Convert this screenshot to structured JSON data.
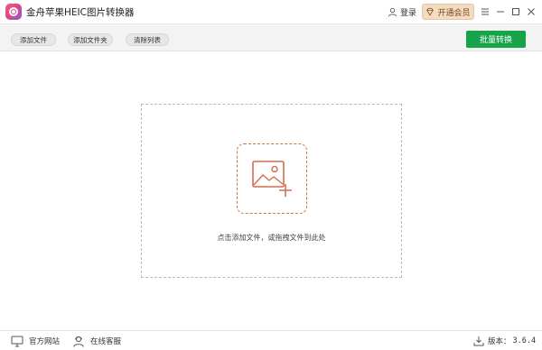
{
  "app": {
    "title": "金舟苹果HEIC图片转换器",
    "logo_colors": [
      "#f45a8b",
      "#8f58d8"
    ]
  },
  "header": {
    "login_label": "登录",
    "login_icon": "user-icon",
    "vip_label": "开通会员",
    "vip_icon": "diamond-icon",
    "window_controls": [
      "menu-icon",
      "minimize-icon",
      "maximize-icon",
      "close-icon"
    ]
  },
  "toolbar": {
    "add_file_label": "添加文件",
    "add_folder_label": "添加文件夹",
    "clear_list_label": "清除列表",
    "batch_convert_label": "批量转换",
    "accent": "#16a34a"
  },
  "main": {
    "drop_icon": "add-image-icon",
    "drop_hint": "点击添加文件，或拖拽文件到此处",
    "accent": "#d36d4c"
  },
  "statusbar": {
    "website_label": "官方网站",
    "website_icon": "monitor-icon",
    "service_label": "在线客服",
    "service_icon": "support-agent-icon",
    "version_label": "版本：",
    "version_number": "3.6.4",
    "version_icon": "download-icon"
  }
}
